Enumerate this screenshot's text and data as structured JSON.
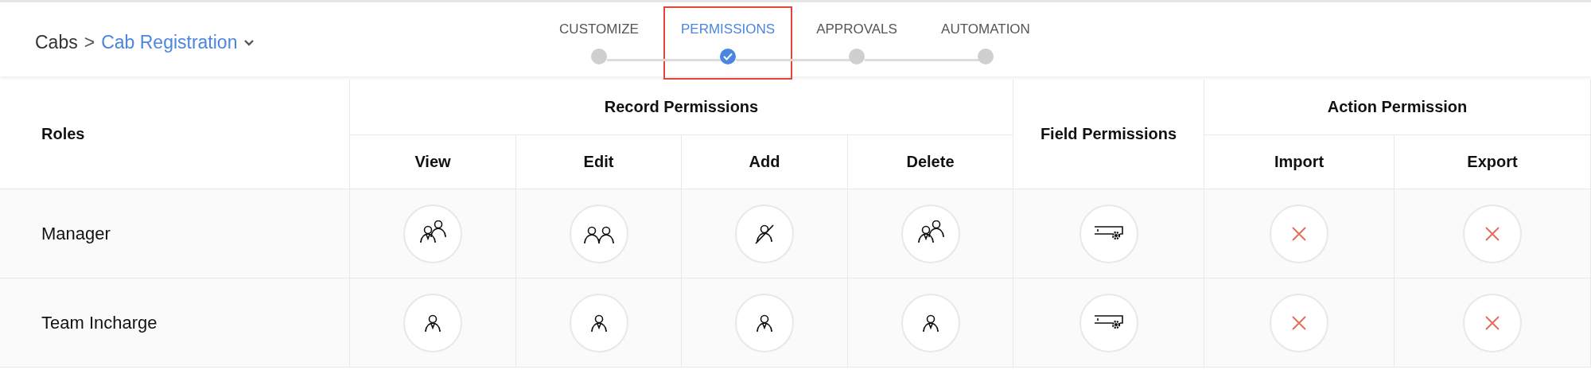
{
  "breadcrumb": {
    "parent": "Cabs",
    "separator": ">",
    "current": "Cab Registration"
  },
  "steps": [
    {
      "label": "CUSTOMIZE",
      "selected": false
    },
    {
      "label": "PERMISSIONS",
      "selected": true
    },
    {
      "label": "APPROVALS",
      "selected": false
    },
    {
      "label": "AUTOMATION",
      "selected": false
    }
  ],
  "table": {
    "roles_header": "Roles",
    "groups": [
      {
        "label": "Record Permissions",
        "columns": [
          "View",
          "Edit",
          "Add",
          "Delete"
        ]
      },
      {
        "label": "Field Permissions"
      },
      {
        "label": "Action Permission",
        "columns": [
          "Import",
          "Export"
        ]
      }
    ],
    "rows": [
      {
        "role": "Manager",
        "cells": [
          {
            "kind": "admin-users"
          },
          {
            "kind": "users"
          },
          {
            "kind": "no-user"
          },
          {
            "kind": "admin-users"
          },
          {
            "kind": "field-settings"
          },
          {
            "kind": "denied"
          },
          {
            "kind": "denied"
          }
        ]
      },
      {
        "role": "Team Incharge",
        "cells": [
          {
            "kind": "admin"
          },
          {
            "kind": "admin"
          },
          {
            "kind": "admin"
          },
          {
            "kind": "admin"
          },
          {
            "kind": "field-settings"
          },
          {
            "kind": "denied"
          },
          {
            "kind": "denied"
          }
        ]
      }
    ]
  }
}
